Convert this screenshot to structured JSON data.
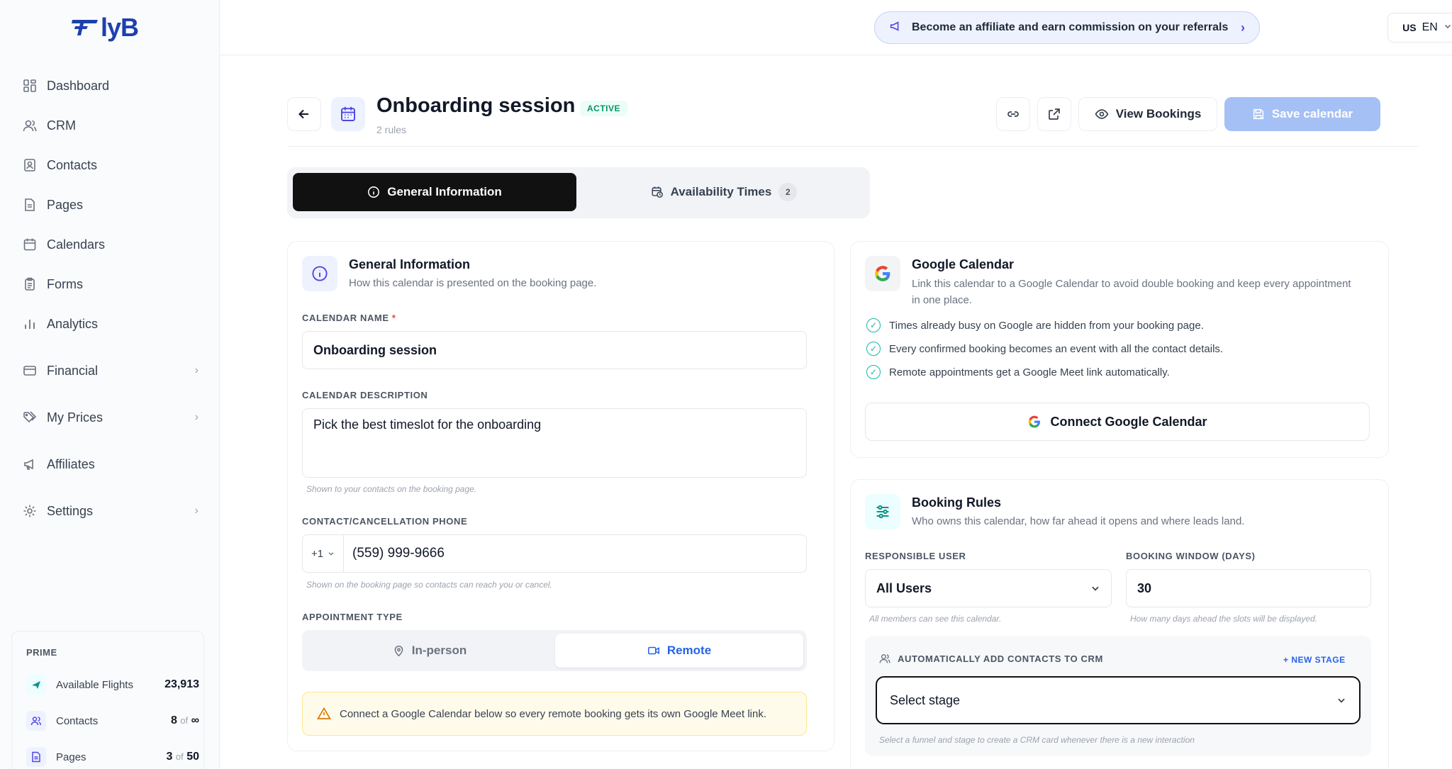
{
  "app": {
    "logo_text": "lyB"
  },
  "sidebar": {
    "items": [
      {
        "label": "Dashboard"
      },
      {
        "label": "CRM"
      },
      {
        "label": "Contacts"
      },
      {
        "label": "Pages"
      },
      {
        "label": "Calendars"
      },
      {
        "label": "Forms"
      },
      {
        "label": "Analytics"
      },
      {
        "label": "Financial"
      },
      {
        "label": "My Prices"
      },
      {
        "label": "Affiliates"
      },
      {
        "label": "Settings"
      }
    ],
    "plan": {
      "title": "PRIME",
      "rows": [
        {
          "label": "Available Flights",
          "value": "23,913"
        },
        {
          "label": "Contacts",
          "value": "8",
          "of": "of",
          "limit": "∞"
        },
        {
          "label": "Pages",
          "value": "3",
          "of": "of",
          "limit": "50"
        }
      ]
    }
  },
  "topbar": {
    "promo": "Become an affiliate and earn commission on your referrals",
    "lang_flag": "US",
    "lang_code": "EN"
  },
  "header": {
    "title": "Onboarding session",
    "status": "ACTIVE",
    "subtitle": "2 rules",
    "view_bookings": "View Bookings",
    "save": "Save calendar"
  },
  "tabs": [
    {
      "label": "General Information"
    },
    {
      "label": "Availability Times",
      "count": "2"
    }
  ],
  "general": {
    "title": "General Information",
    "subtitle": "How this calendar is presented on the booking page.",
    "name_label": "CALENDAR NAME",
    "name_required": "*",
    "name_value": "Onboarding session",
    "desc_label": "CALENDAR DESCRIPTION",
    "desc_value": "Pick the best timeslot for the onboarding",
    "desc_hint": "Shown to your contacts on the booking page.",
    "phone_label": "CONTACT/CANCELLATION PHONE",
    "phone_code": "+1",
    "phone_value": "(559) 999-9666",
    "phone_hint": "Shown on the booking page so contacts can reach you or cancel.",
    "type_label": "APPOINTMENT TYPE",
    "type_inperson": "In-person",
    "type_remote": "Remote",
    "warning": "Connect a Google Calendar below so every remote booking gets its own Google Meet link."
  },
  "google": {
    "title": "Google Calendar",
    "subtitle_line1": "Link this calendar to a Google Calendar to avoid double booking and keep every appointment",
    "subtitle_line2": "in one place.",
    "checks": [
      "Times already busy on Google are hidden from your booking page.",
      "Every confirmed booking becomes an event with all the contact details.",
      "Remote appointments get a Google Meet link automatically."
    ],
    "connect": "Connect Google Calendar"
  },
  "booking": {
    "title": "Booking Rules",
    "subtitle": "Who owns this calendar, how far ahead it opens and where leads land.",
    "user_label": "RESPONSIBLE USER",
    "user_value": "All Users",
    "user_hint": "All members can see this calendar.",
    "window_label": "BOOKING WINDOW (DAYS)",
    "window_value": "30",
    "window_hint": "How many days ahead the slots will be displayed.",
    "crm_label": "AUTOMATICALLY ADD CONTACTS TO CRM",
    "new_stage": "+ NEW STAGE",
    "stage_placeholder": "Select stage",
    "stage_hint": "Select a funnel and stage to create a CRM card whenever there is a new interaction"
  }
}
